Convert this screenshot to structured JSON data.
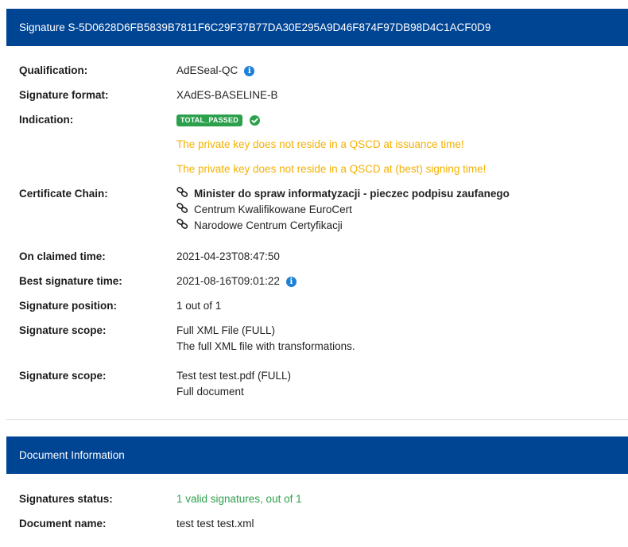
{
  "signature_panel": {
    "header": "Signature S-5D0628D6FB5839B7811F6C29F37B77DA30E295A9D46F874F97DB98D4C1ACF0D9",
    "qualification": {
      "label": "Qualification:",
      "value": "AdESeal-QC"
    },
    "format": {
      "label": "Signature format:",
      "value": "XAdES-BASELINE-B"
    },
    "indication": {
      "label": "Indication:",
      "badge": "TOTAL_PASSED",
      "warnings": [
        "The private key does not reside in a QSCD at issuance time!",
        "The private key does not reside in a QSCD at (best) signing time!"
      ]
    },
    "certificate_chain": {
      "label": "Certificate Chain:",
      "items": [
        "Minister do spraw informatyzacji - pieczec podpisu zaufanego",
        "Centrum Kwalifikowane EuroCert",
        "Narodowe Centrum Certyfikacji"
      ]
    },
    "claimed_time": {
      "label": "On claimed time:",
      "value": "2021-04-23T08:47:50"
    },
    "best_time": {
      "label": "Best signature time:",
      "value": "2021-08-16T09:01:22"
    },
    "position": {
      "label": "Signature position:",
      "value": "1 out of 1"
    },
    "scopes": [
      {
        "label": "Signature scope:",
        "name": "Full XML File (FULL)",
        "description": "The full XML file with transformations."
      },
      {
        "label": "Signature scope:",
        "name": "Test test test.pdf (FULL)",
        "description": "Full document"
      }
    ]
  },
  "document_panel": {
    "header": "Document Information",
    "status": {
      "label": "Signatures status:",
      "value": "1 valid signatures, out of 1"
    },
    "name": {
      "label": "Document name:",
      "value": "test test test.xml"
    }
  },
  "colors": {
    "header_bg": "#004494",
    "success": "#2ca14c",
    "warning": "#f5b100",
    "info": "#1d7fd8"
  }
}
